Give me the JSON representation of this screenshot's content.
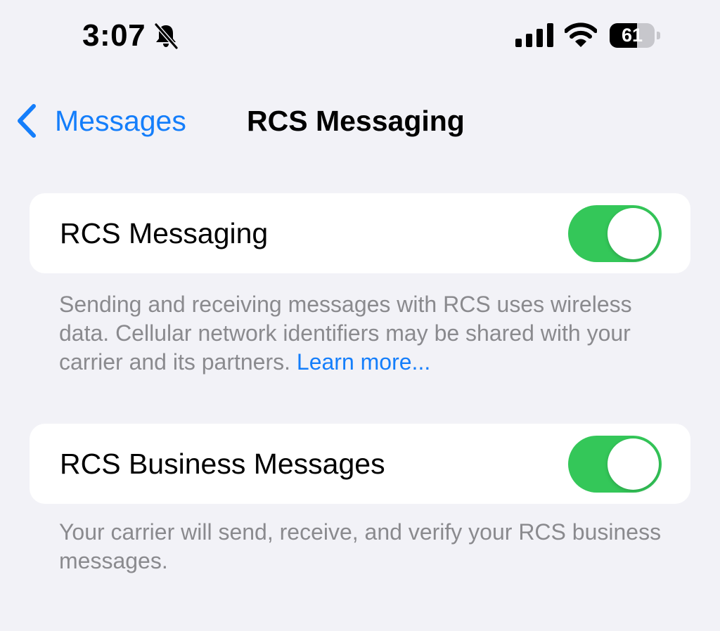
{
  "status_bar": {
    "time": "3:07",
    "silent_icon": "bell-slash-icon",
    "signal_icon": "cellular-signal-icon",
    "wifi_icon": "wifi-icon",
    "battery_percent": "61",
    "battery_level": 0.61
  },
  "nav": {
    "back_icon": "chevron-left-icon",
    "back_label": "Messages",
    "title": "RCS Messaging"
  },
  "settings": [
    {
      "label": "RCS Messaging",
      "enabled": true,
      "footer": "Sending and receiving messages with RCS uses wireless data. Cellular network identifiers may be shared with your carrier and its partners.",
      "footer_link": "Learn more..."
    },
    {
      "label": "RCS Business Messages",
      "enabled": true,
      "footer": "Your carrier will send, receive, and verify your RCS business messages."
    }
  ],
  "colors": {
    "background": "#f2f2f7",
    "accent": "#147efb",
    "toggle_on": "#34c759",
    "secondary_text": "#8a8a8e"
  }
}
